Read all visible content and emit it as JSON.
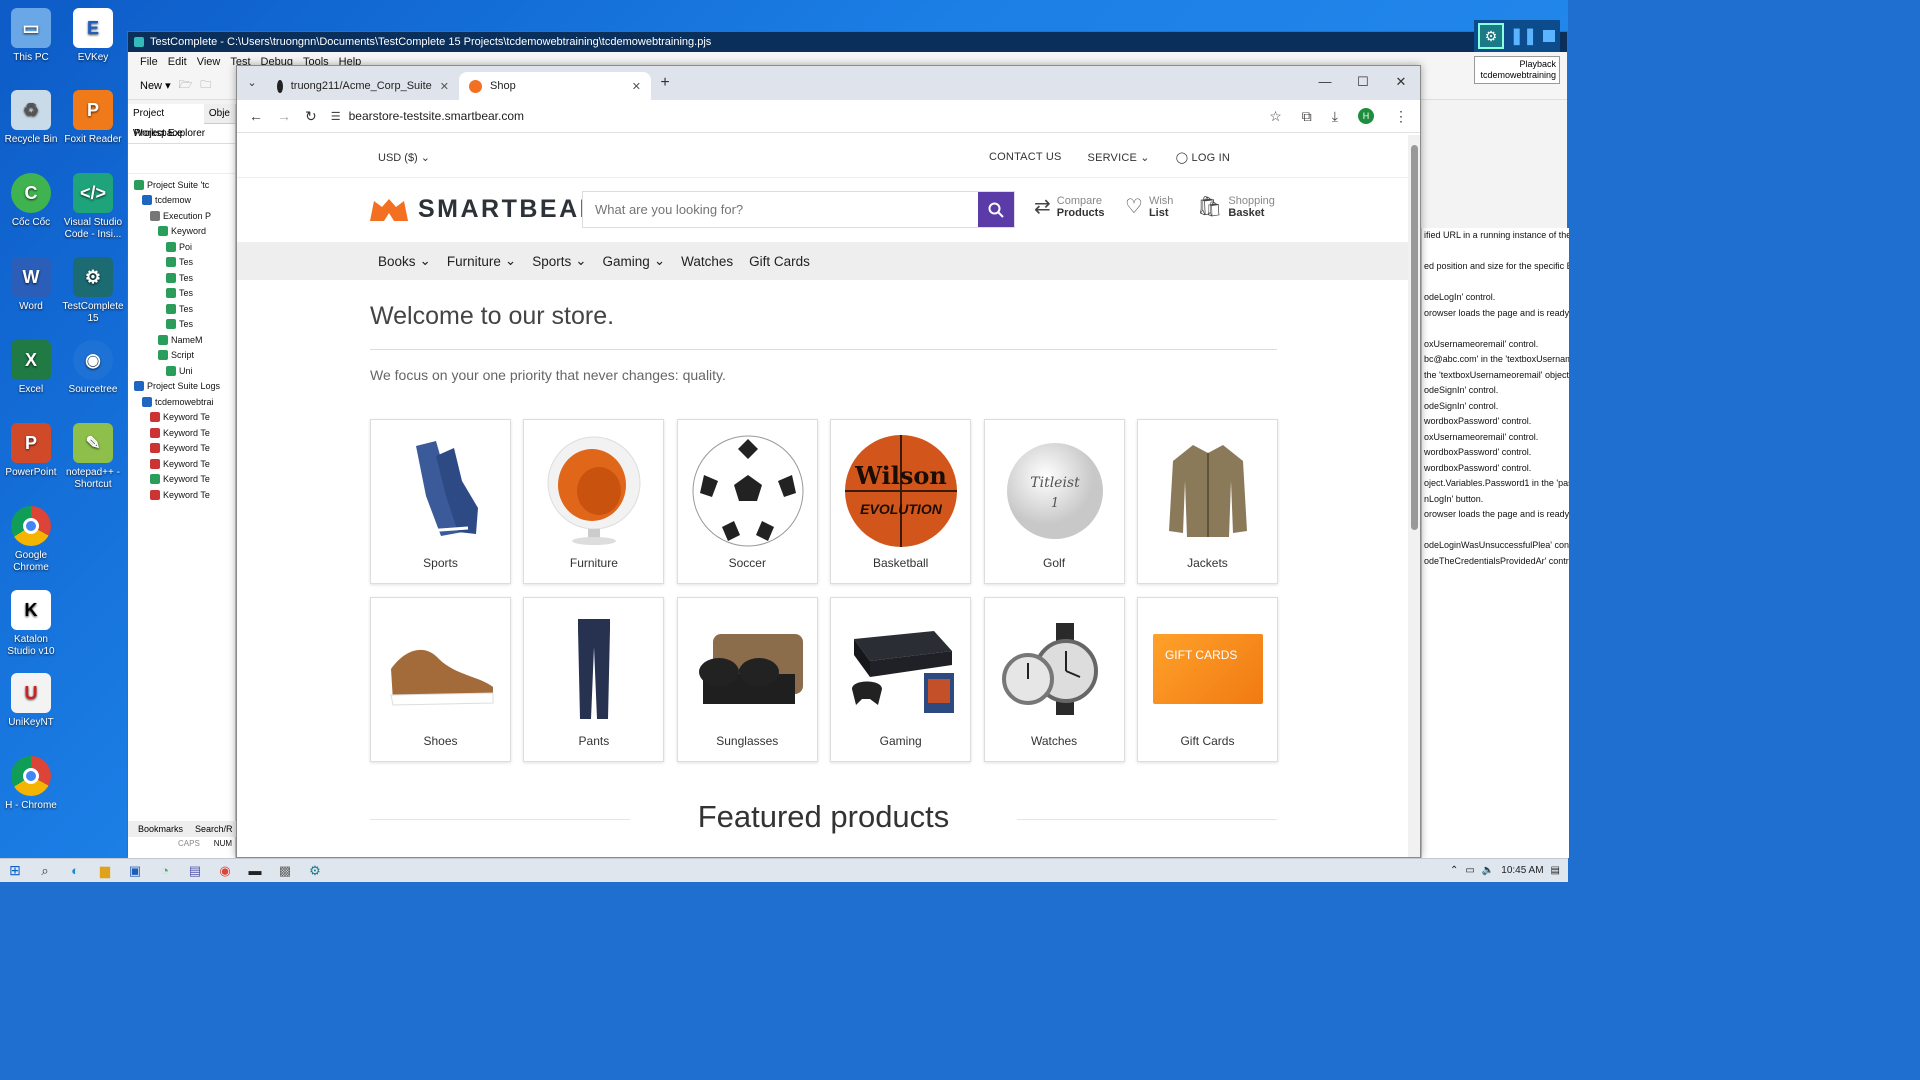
{
  "desktop": {
    "icons": [
      {
        "label": "This PC"
      },
      {
        "label": "EVKey"
      },
      {
        "label": "Recycle Bin"
      },
      {
        "label": "Foxit Reader"
      },
      {
        "label": "Cốc Cốc"
      },
      {
        "label": "Visual Studio Code - Insi..."
      },
      {
        "label": "Word"
      },
      {
        "label": "TestComplete 15"
      },
      {
        "label": "Excel"
      },
      {
        "label": "Sourcetree"
      },
      {
        "label": "PowerPoint"
      },
      {
        "label": "notepad++ - Shortcut"
      },
      {
        "label": "Google Chrome"
      },
      {
        "label": "Katalon Studio v10"
      },
      {
        "label": "UniKeyNT"
      },
      {
        "label": "H - Chrome"
      }
    ]
  },
  "testcomplete": {
    "title": "TestComplete - C:\\Users\\truongnn\\Documents\\TestComplete 15 Projects\\tcdemowebtraining\\tcdemowebtraining.pjs",
    "menu": [
      "File",
      "Edit",
      "View",
      "Test",
      "Debug",
      "Tools",
      "Help"
    ],
    "toolbar_new": "New",
    "left_tabs": [
      "Project Workspace",
      "Obje"
    ],
    "project_explorer": "Project Explorer",
    "tree": [
      "Project Suite 'tc",
      "tcdemow",
      "Execution P",
      "Keyword",
      "Poi",
      "Tes",
      "Tes",
      "Tes",
      "Tes",
      "Tes",
      "NameM",
      "Script",
      "Uni",
      "Project Suite Logs",
      "tcdemowebtrai",
      "Keyword Te",
      "Keyword Te",
      "Keyword Te",
      "Keyword Te",
      "Keyword Te",
      "Keyword Te"
    ],
    "bottom_tabs": [
      "Bookmarks",
      "Search/R"
    ],
    "status": [
      "CAPS",
      "NUM"
    ],
    "log_lines": [
      "ified URL in a running instance of the",
      "",
      "ed position and size for the specific Br",
      "",
      "odeLogIn' control.",
      "orowser loads the page and is ready t",
      "",
      "oxUsernameoremail' control.",
      "bc@abc.com' in the 'textboxUsername",
      " the 'textboxUsernameoremail' object",
      "odeSignIn' control.",
      "odeSignIn' control.",
      "wordboxPassword' control.",
      "oxUsernameoremail' control.",
      "wordboxPassword' control.",
      "wordboxPassword' control.",
      "oject.Variables.Password1 in the 'pas",
      "nLogIn' button.",
      "orowser loads the page and is ready t",
      "",
      "odeLoginWasUnsuccessfulPlea' contr",
      "odeTheCredentialsProvidedAr' contro"
    ],
    "playback": {
      "label": "Playback",
      "project": "tcdemowebtraining"
    }
  },
  "chrome": {
    "tabs": [
      {
        "title": "truong211/Acme_Corp_Suite",
        "active": false
      },
      {
        "title": "Shop",
        "active": true
      }
    ],
    "url": "bearstore-testsite.smartbear.com",
    "profile_initial": "H"
  },
  "store": {
    "currency": "USD  ($)",
    "top_links": [
      "CONTACT US",
      "SERVICE",
      "LOG IN"
    ],
    "logo": "SMARTBEAR",
    "search_placeholder": "What are you looking for?",
    "header_links": [
      {
        "small": "Compare",
        "big": "Products"
      },
      {
        "small": "Wish",
        "big": "List"
      },
      {
        "small": "Shopping",
        "big": "Basket"
      }
    ],
    "nav": [
      {
        "label": "Books",
        "dropdown": true
      },
      {
        "label": "Furniture",
        "dropdown": true
      },
      {
        "label": "Sports",
        "dropdown": true
      },
      {
        "label": "Gaming",
        "dropdown": true
      },
      {
        "label": "Watches",
        "dropdown": false
      },
      {
        "label": "Gift Cards",
        "dropdown": false
      }
    ],
    "welcome": "Welcome to our store.",
    "tagline": "We focus on your one priority that never changes: quality.",
    "categories": [
      "Sports",
      "Furniture",
      "Soccer",
      "Basketball",
      "Golf",
      "Jackets",
      "Shoes",
      "Pants",
      "Sunglasses",
      "Gaming",
      "Watches",
      "Gift Cards"
    ],
    "basketball_brand": "Wilson",
    "basketball_model": "EVOLUTION",
    "golf_brand": "Titleist",
    "golf_number": "1",
    "giftcard_text": "GIFT CARDS",
    "featured": "Featured products"
  },
  "taskbar": {
    "time": "10:45 AM"
  }
}
